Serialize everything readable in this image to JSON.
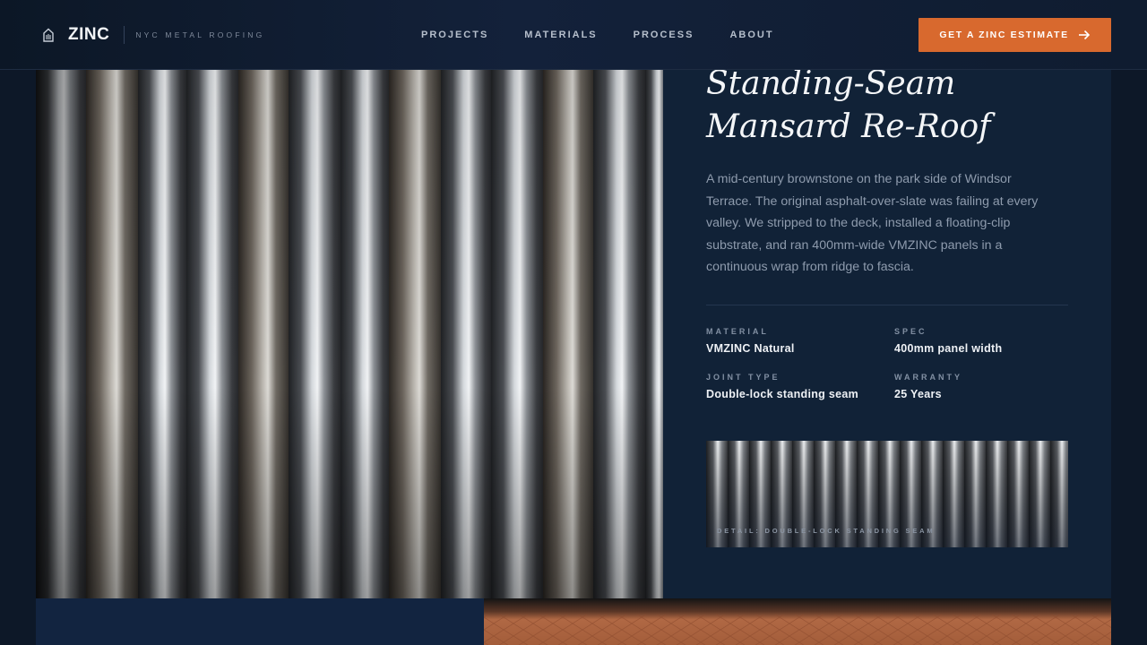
{
  "nav": {
    "brand": "ZINC",
    "tagline": "NYC METAL ROOFING",
    "items": [
      {
        "label": "PROJECTS"
      },
      {
        "label": "MATERIALS"
      },
      {
        "label": "PROCESS"
      },
      {
        "label": "ABOUT"
      }
    ],
    "cta_label": "GET A ZINC ESTIMATE",
    "cta_icon": "arrow-right-icon"
  },
  "project": {
    "title": "Standing-Seam Mansard Re-Roof",
    "description": "A mid-century brownstone on the park side of Windsor Terrace. The original asphalt-over-slate was failing at every valley. We stripped to the deck, installed a floating-clip substrate, and ran 400mm-wide VMZINC panels in a continuous wrap from ridge to fascia.",
    "specs": [
      {
        "label": "MATERIAL",
        "value": "VMZINC Natural"
      },
      {
        "label": "SPEC",
        "value": "400mm panel width"
      },
      {
        "label": "JOINT TYPE",
        "value": "Double-lock standing seam"
      },
      {
        "label": "WARRANTY",
        "value": "25 Years"
      }
    ],
    "thumb_caption": "DETAIL: DOUBLE-LOCK STANDING SEAM"
  },
  "colors": {
    "accent": "#d8692e",
    "background": "#0e1a2b",
    "panel": "#112237"
  }
}
